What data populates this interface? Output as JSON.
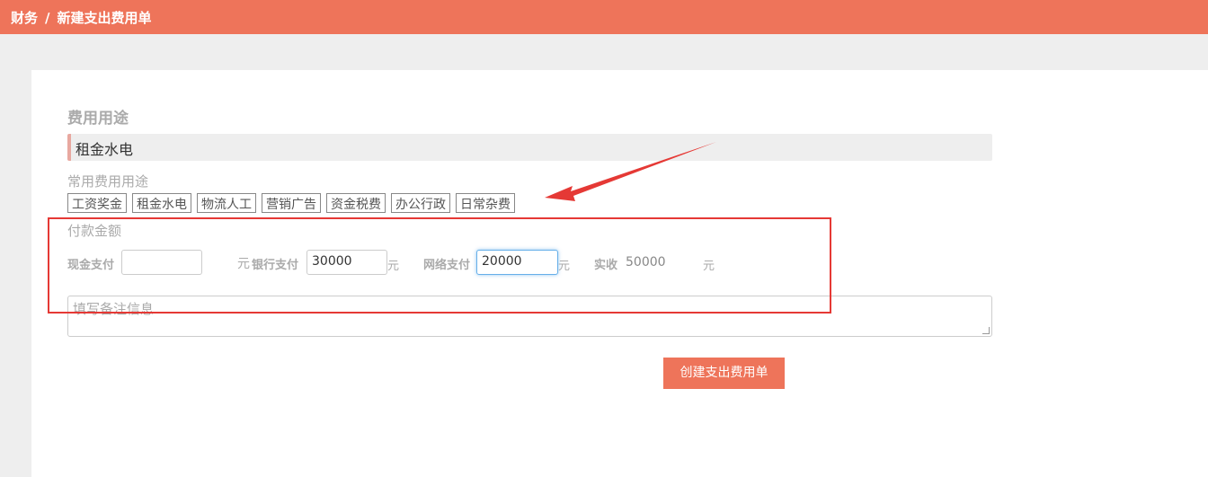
{
  "header": {
    "crumb_root": "财务",
    "separator": "/",
    "crumb_current": "新建支出费用单"
  },
  "form": {
    "purpose_label": "费用用途",
    "purpose_value": "租金水电",
    "common_label": "常用费用用途",
    "common_tags": [
      "工资奖金",
      "租金水电",
      "物流人工",
      "营销广告",
      "资金税费",
      "办公行政",
      "日常杂费"
    ],
    "payment_label": "付款金额",
    "cash_label": "现金支付",
    "cash_value": "",
    "cash_unit": "元",
    "bank_label": "银行支付",
    "bank_value": "30000",
    "bank_unit": "元",
    "online_label": "网络支付",
    "online_value": "20000",
    "online_unit": "元",
    "received_label": "实收",
    "received_value": "50000",
    "received_unit": "元",
    "note_placeholder": "填写备注信息",
    "submit_label": "创建支出费用单"
  },
  "colors": {
    "accent": "#ee745a",
    "annotation": "#e53935"
  }
}
